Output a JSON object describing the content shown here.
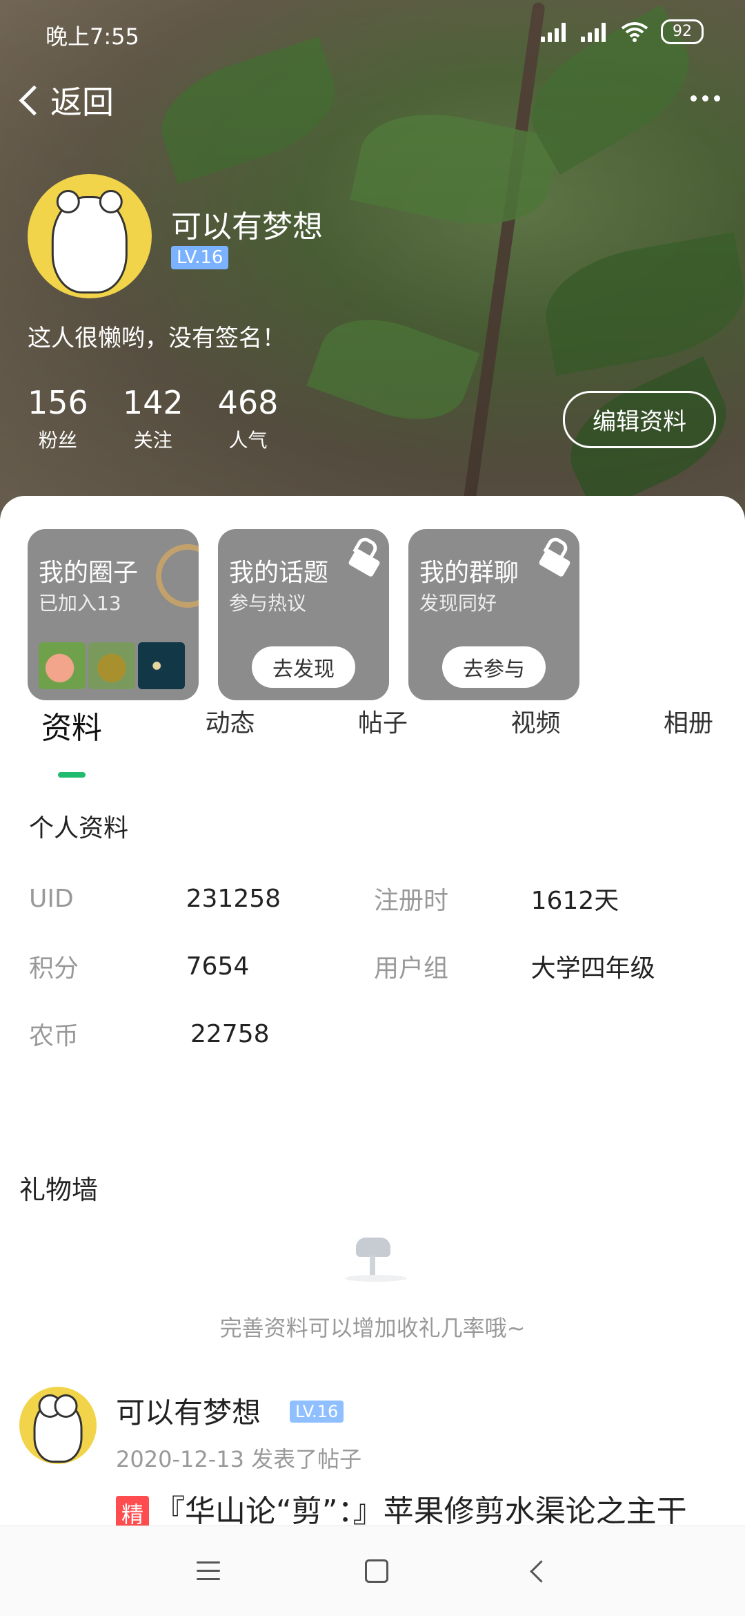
{
  "status_bar": {
    "time": "晚上7:55",
    "battery": "92"
  },
  "topbar": {
    "back_label": "返回"
  },
  "profile": {
    "name": "可以有梦想",
    "level": "LV.16",
    "bio": "这人很懒哟，没有签名！",
    "stats": [
      {
        "value": "156",
        "label": "粉丝"
      },
      {
        "value": "142",
        "label": "关注"
      },
      {
        "value": "468",
        "label": "人气"
      }
    ],
    "edit_button": "编辑资料"
  },
  "cards": [
    {
      "title": "我的圈子",
      "subtitle": "已加入13",
      "button": ""
    },
    {
      "title": "我的话题",
      "subtitle": "参与热议",
      "button": "去发现"
    },
    {
      "title": "我的群聊",
      "subtitle": "发现同好",
      "button": "去参与"
    }
  ],
  "tabs": [
    "资料",
    "动态",
    "帖子",
    "视频",
    "相册"
  ],
  "info": {
    "section_title": "个人资料",
    "rows": [
      {
        "k1": "UID",
        "v1": "231258",
        "k2": "注册时",
        "v2": "1612天"
      },
      {
        "k1": "积分",
        "v1": "7654",
        "k2": "用户组",
        "v2": "大学四年级"
      },
      {
        "k1": "农币",
        "v1": "22758",
        "k2": "",
        "v2": ""
      }
    ]
  },
  "gift": {
    "title": "礼物墙",
    "empty_text": "完善资料可以增加收礼几率哦~"
  },
  "post": {
    "author": "可以有梦想",
    "level": "LV.16",
    "meta": "2020-12-13 发表了帖子",
    "badge": "精",
    "title": "『华山论“剪”：』苹果修剪水渠论之主干"
  },
  "colors": {
    "accent": "#1fbb6f",
    "level_badge": "#7ab2ff",
    "jing_badge": "#ff4d4f",
    "card_bg": "#8c8c8c"
  }
}
